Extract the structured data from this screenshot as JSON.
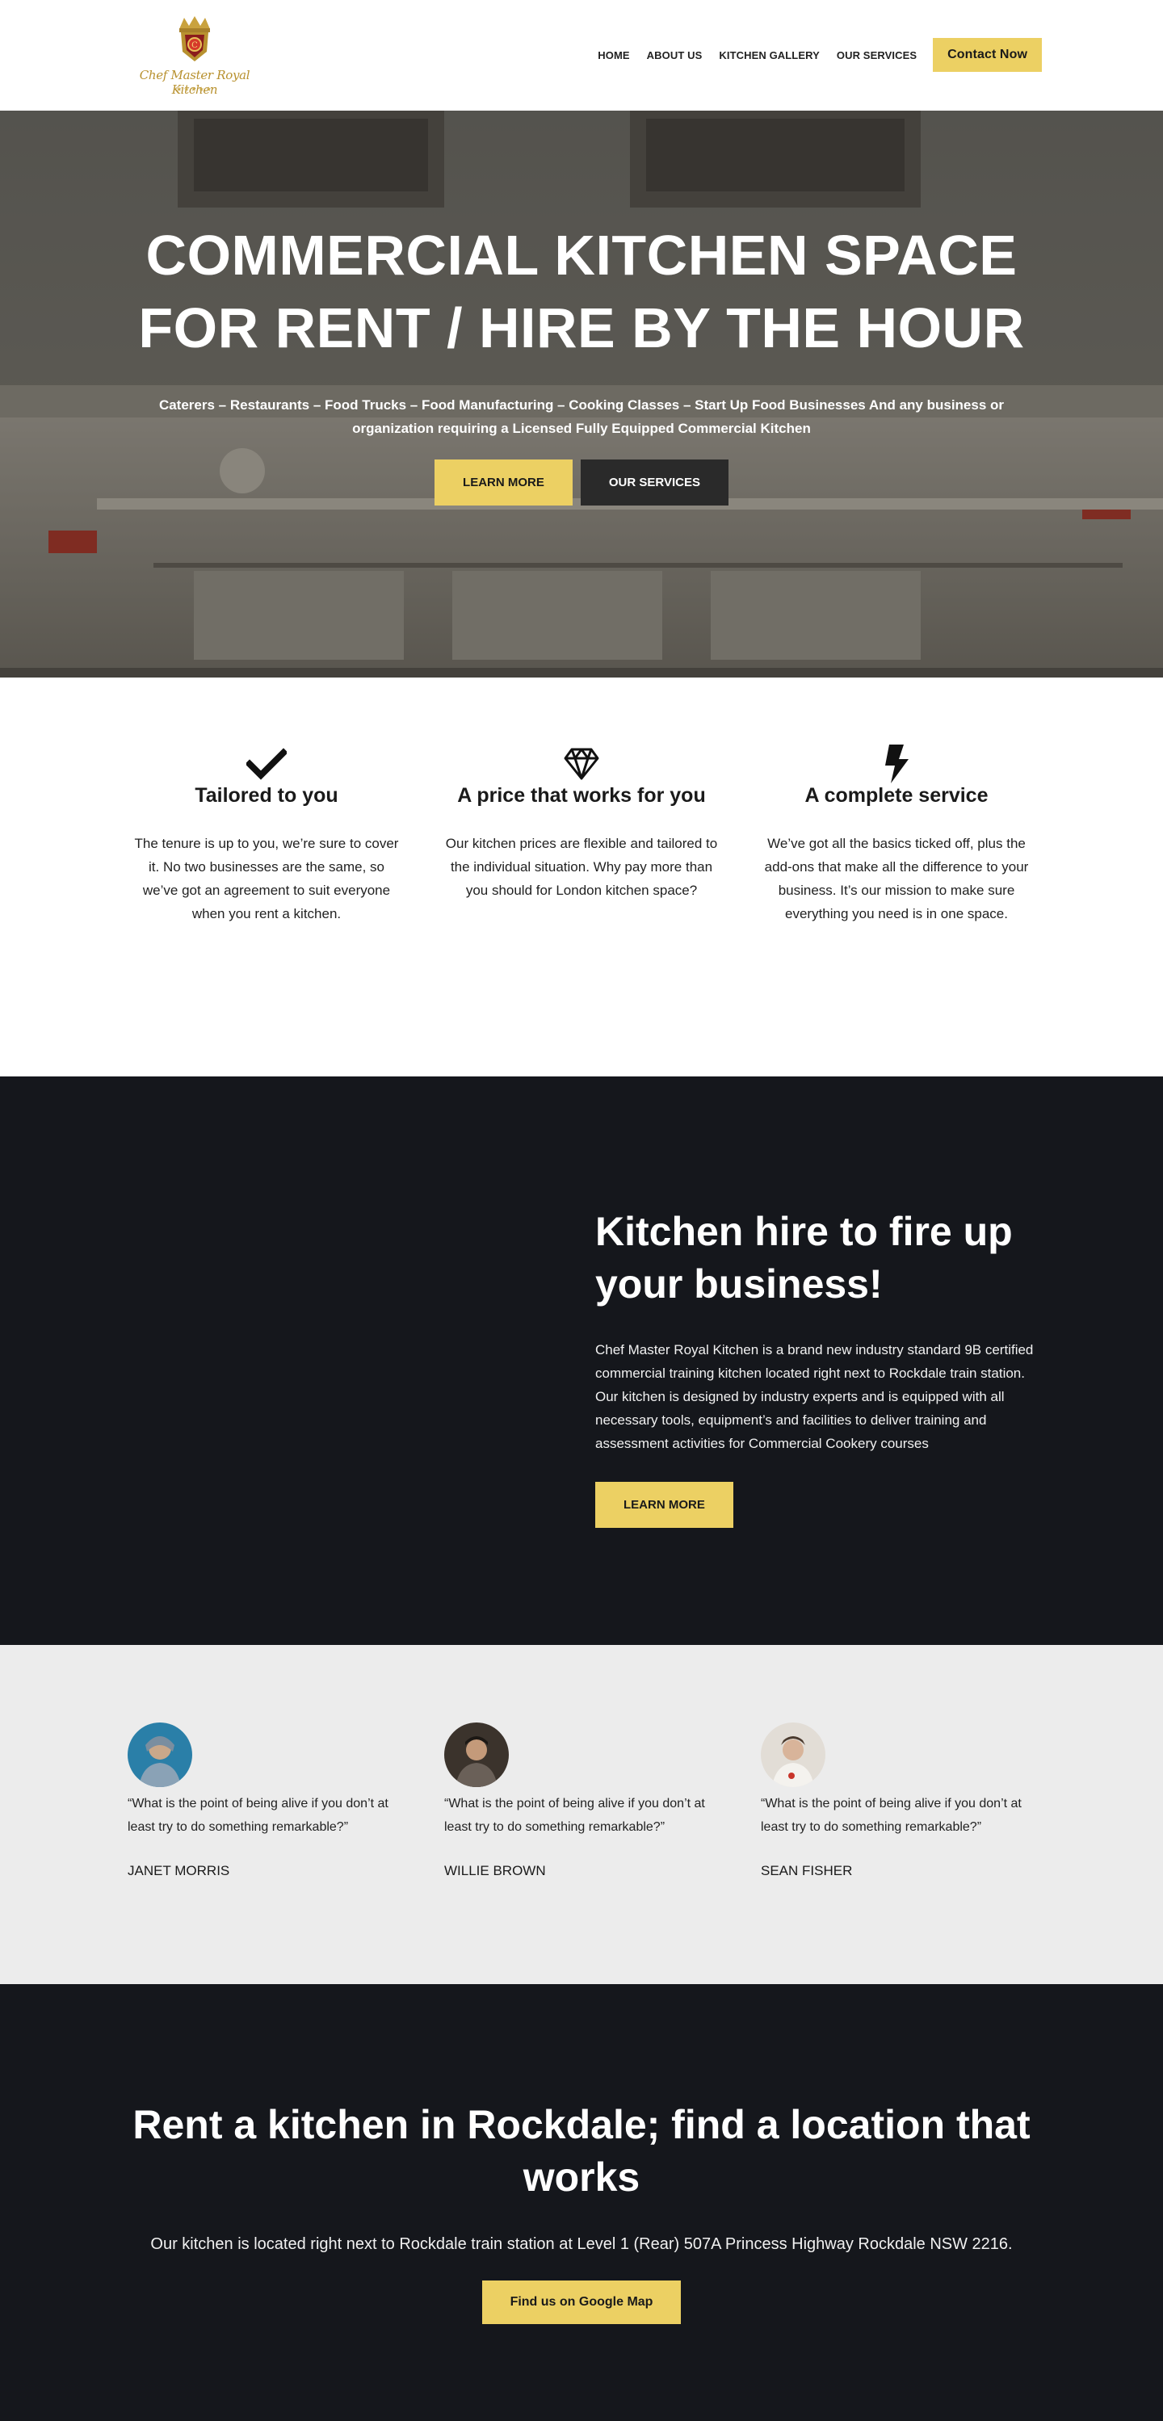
{
  "header": {
    "logo_text": "Chef Master Royal Kitchen",
    "nav": [
      "HOME",
      "ABOUT US",
      "KITCHEN GALLERY",
      "OUR SERVICES"
    ],
    "cta": "Contact Now"
  },
  "hero": {
    "title_line1": "COMMERCIAL KITCHEN SPACE",
    "title_line2": "FOR RENT / HIRE BY THE HOUR",
    "subtitle": "Caterers – Restaurants – Food Trucks – Food Manufacturing – Cooking Classes – Start Up Food Businesses And any business or organization requiring a Licensed Fully Equipped Commercial Kitchen",
    "learn_more": "LEARN MORE",
    "our_services": "OUR SERVICES"
  },
  "features": [
    {
      "icon": "checkmark-icon",
      "title": "Tailored to you",
      "text": "The tenure is up to you, we’re sure to cover it. No two businesses are the same, so we’ve got an agreement to suit everyone when you rent a kitchen."
    },
    {
      "icon": "diamond-icon",
      "title": "A price that works for you",
      "text": "Our kitchen prices are flexible and tailored to the individual situation. Why pay more than you should for London kitchen space?"
    },
    {
      "icon": "lightning-icon",
      "title": "A complete service",
      "text": "We’ve got all the basics ticked off, plus the add-ons that make all the difference to your business. It’s our mission to make sure everything you need is in one space."
    }
  ],
  "hire": {
    "title": "Kitchen hire to fire up your business!",
    "text": "Chef Master Royal Kitchen is a brand new industry standard 9B certified commercial training kitchen located right next to Rockdale train station. Our kitchen is designed by industry experts and is equipped with all necessary tools, equipment’s and facilities to deliver training and assessment activities for Commercial Cookery courses",
    "button": "LEARN MORE"
  },
  "testimonials": [
    {
      "quote": "“What is the point of being alive if you don’t at least try to do something remarkable?”",
      "name": "JANET MORRIS"
    },
    {
      "quote": "“What is the point of being alive if you don’t at least try to do something remarkable?”",
      "name": "WILLIE BROWN"
    },
    {
      "quote": "“What is the point of being alive if you don’t at least try to do something remarkable?”",
      "name": "SEAN FISHER"
    }
  ],
  "location": {
    "title": "Rent a kitchen in Rockdale; find a location that works",
    "text": "Our kitchen is located right next to Rockdale train station at Level 1 (Rear) 507A Princess Highway Rockdale NSW 2216.",
    "button": "Find us on Google Map"
  },
  "colors": {
    "accent": "#ecd063",
    "dark": "#15171c",
    "light_bg": "#ececec"
  }
}
